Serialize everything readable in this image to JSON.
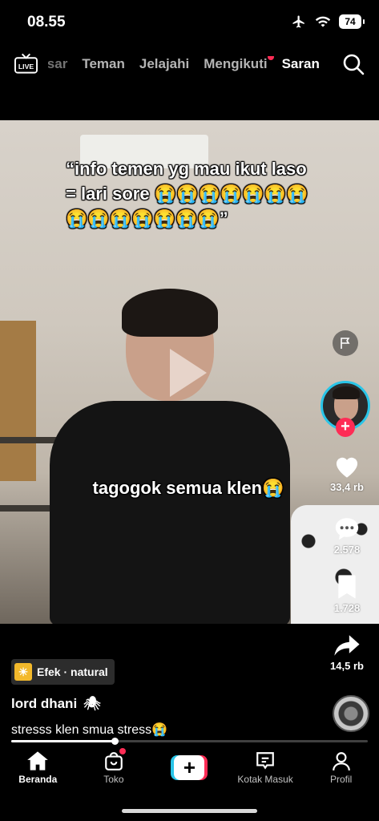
{
  "status_bar": {
    "time": "08.55",
    "battery": "74"
  },
  "top_nav": {
    "live_label": "LIVE",
    "tabs": [
      {
        "label": "Pasar",
        "state": "faded"
      },
      {
        "label": "Teman",
        "state": "normal"
      },
      {
        "label": "Jelajahi",
        "state": "normal"
      },
      {
        "label": "Mengikuti",
        "state": "normal",
        "notification_dot": true
      },
      {
        "label": "Saran",
        "state": "active"
      }
    ]
  },
  "video": {
    "caption_top": "“info temen yg mau ikut laso = lari sore 😭😭😭😭😭😭😭😭😭😭😭😭😭😭”",
    "caption_mid": "tagogok semua klen😭",
    "paused": true
  },
  "side_rail": {
    "likes": "33,4 rb",
    "comments": "2.578",
    "saves": "1.728",
    "shares": "14,5 rb"
  },
  "info": {
    "effect_label": "Efek · natural",
    "effect_icon": "☀",
    "username": "lord dhani",
    "username_emoji": "🕷",
    "description": "stresss klen smua stress😭"
  },
  "progress": {
    "fraction": 0.29
  },
  "bottom_nav": {
    "home_label": "Beranda",
    "shop_label": "Toko",
    "inbox_label": "Kotak Masuk",
    "profile_label": "Profil",
    "create_symbol": "+"
  },
  "colors": {
    "accent_red": "#fe2c55",
    "accent_cyan": "#29c5e8"
  }
}
